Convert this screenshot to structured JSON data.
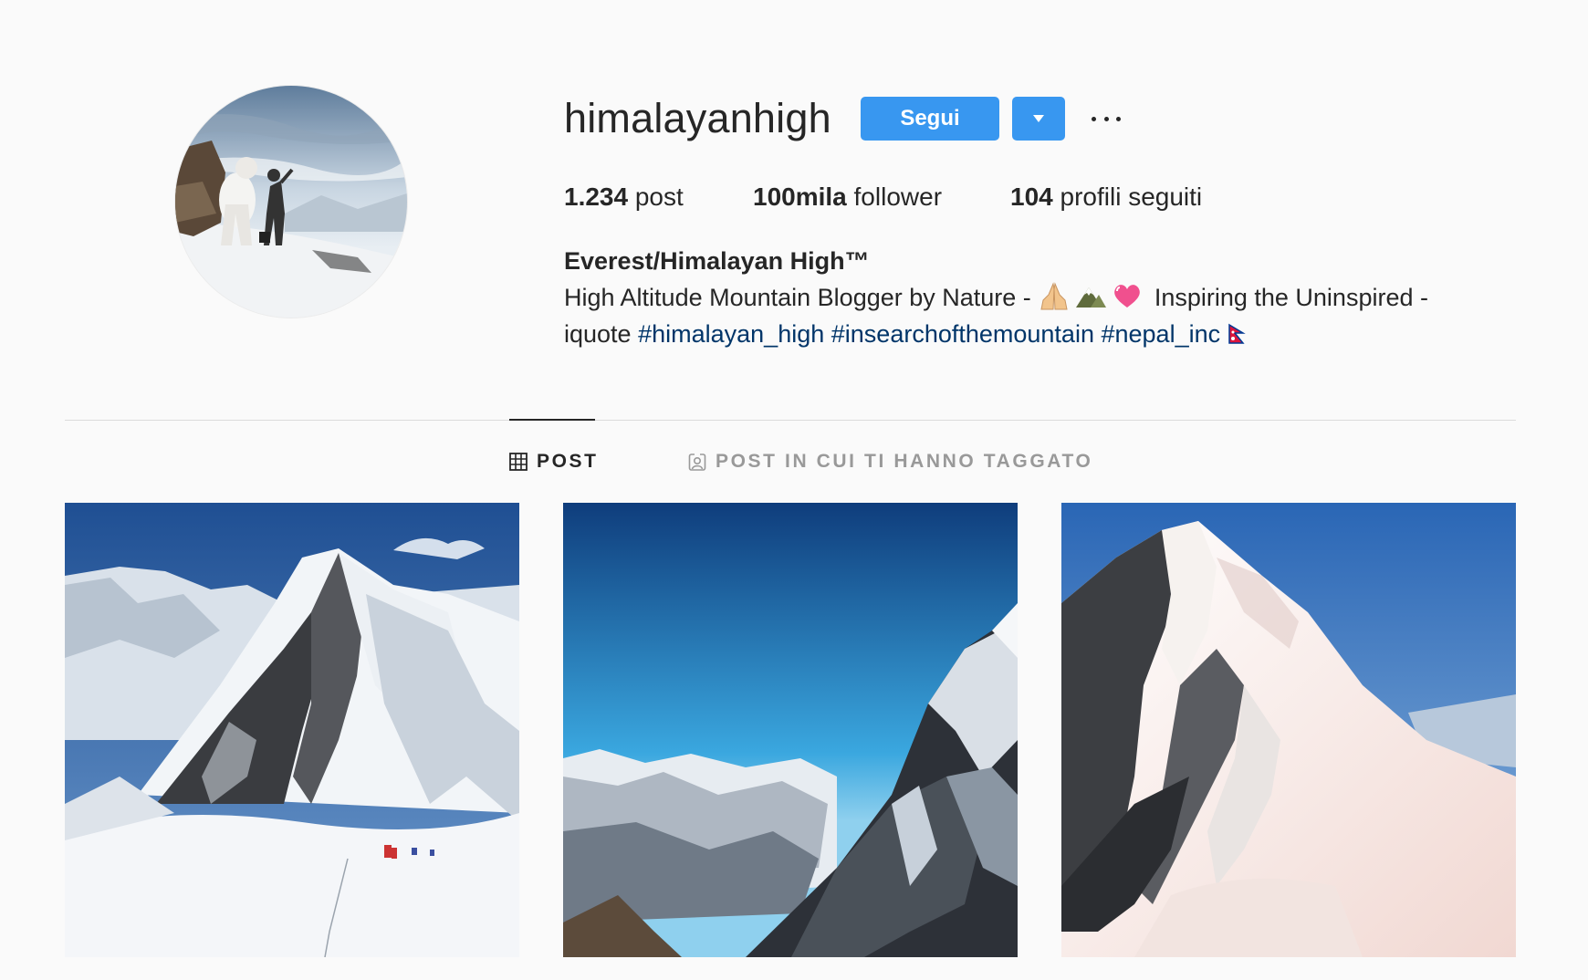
{
  "profile": {
    "username": "himalayanhigh",
    "follow_label": "Segui",
    "stats": [
      {
        "value": "1.234",
        "label": "post"
      },
      {
        "value": "100mila",
        "label": "follower"
      },
      {
        "value": "104",
        "label": "profili seguiti"
      }
    ],
    "full_name": "Everest/Himalayan High™",
    "bio_text_1": "High Altitude Mountain Blogger by Nature -",
    "bio_text_2": "Inspiring the Uninspired -",
    "bio_text_3": "iquote",
    "hashtags": [
      "#himalayan_high",
      "#insearchofthemountain",
      "#nepal_inc"
    ],
    "bio_emojis": [
      "folded-hands-icon",
      "mountain-icon",
      "heart-icon",
      "nepal-flag-icon"
    ]
  },
  "tabs": {
    "posts": "POST",
    "tagged": "POST IN CUI TI HANNO TAGGATO"
  },
  "colors": {
    "accent": "#3897f0",
    "hashtag": "#003569",
    "background": "#fafafa"
  },
  "posts": [
    {
      "icon": "mountain-climbers-photo"
    },
    {
      "icon": "mountain-peak-blue-sky-photo"
    },
    {
      "icon": "snowy-summit-ridge-photo"
    }
  ]
}
